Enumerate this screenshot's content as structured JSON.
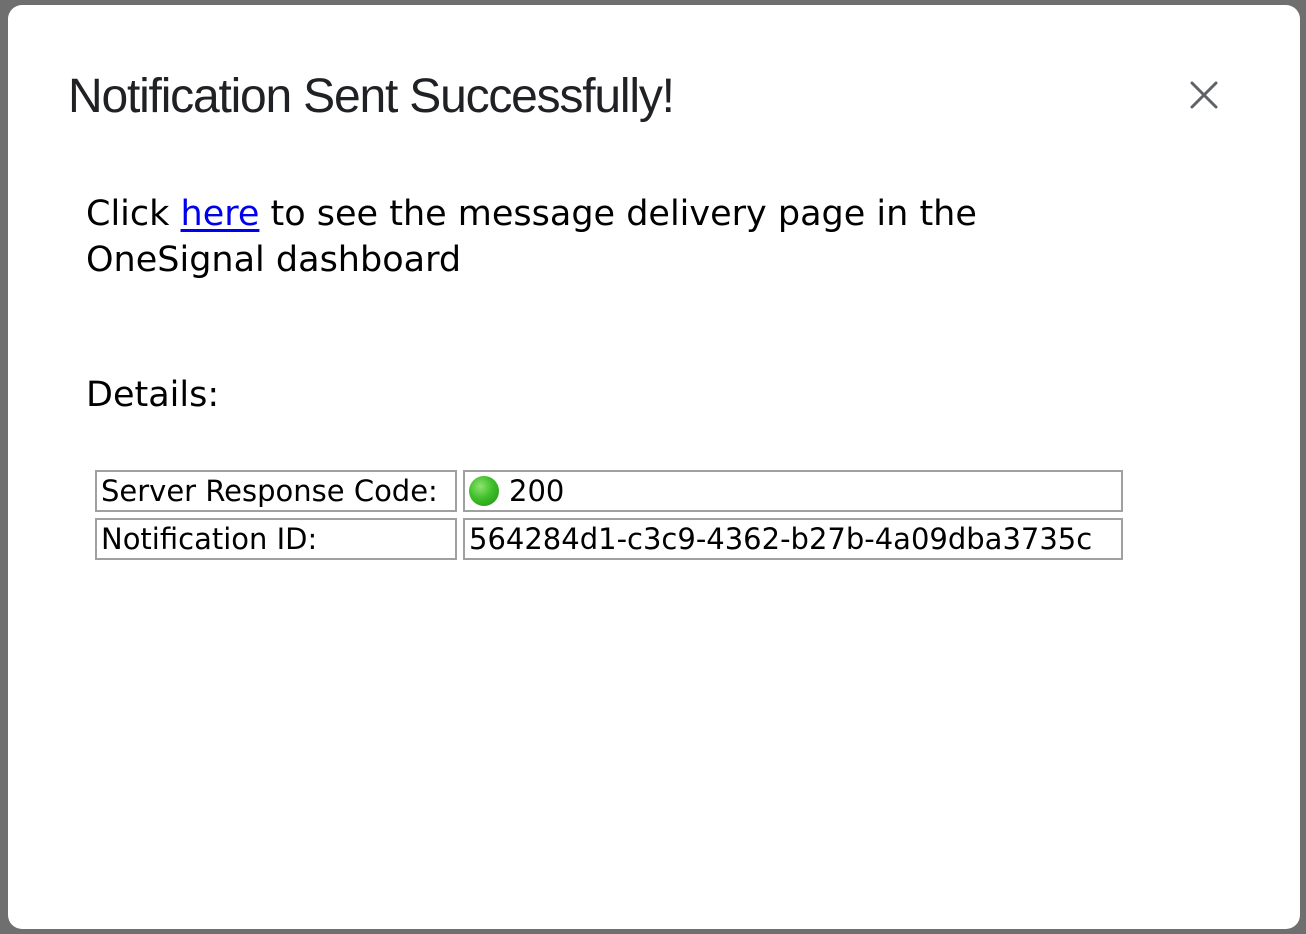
{
  "dialog": {
    "title": "Notification Sent Successfully!",
    "close_icon": "close-icon",
    "message": {
      "prefix": "Click ",
      "link_text": "here",
      "suffix": " to see the message delivery page in the OneSignal dashboard"
    },
    "details_heading": "Details:",
    "details": [
      {
        "label": "Server Response Code:",
        "status_icon": "green-circle-icon",
        "value": "200"
      },
      {
        "label": "Notification ID:",
        "value": "564284d1-c3c9-4362-b27b-4a09dba3735c"
      }
    ]
  },
  "colors": {
    "link": "#0000ee",
    "status_ok": "#3fbf2a",
    "title": "#202124",
    "cell_border": "#a0a0a0"
  }
}
